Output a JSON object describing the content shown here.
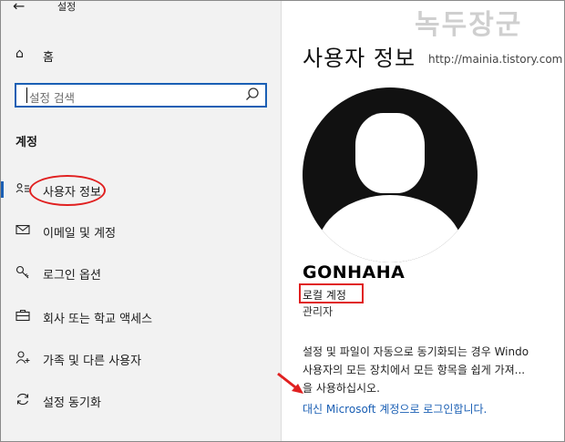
{
  "window": {
    "title": "설정",
    "back_icon": "back-arrow-icon"
  },
  "sidebar": {
    "home_label": "홈",
    "search_placeholder": "설정 검색",
    "section_title": "계정",
    "items": [
      {
        "label": "사용자 정보",
        "icon": "person-list-icon",
        "active": true
      },
      {
        "label": "이메일 및 계정",
        "icon": "mail-icon",
        "active": false
      },
      {
        "label": "로그인 옵션",
        "icon": "key-icon",
        "active": false
      },
      {
        "label": "회사 또는 학교 액세스",
        "icon": "briefcase-icon",
        "active": false
      },
      {
        "label": "가족 및 다른 사용자",
        "icon": "add-person-icon",
        "active": false
      },
      {
        "label": "설정 동기화",
        "icon": "sync-icon",
        "active": false
      }
    ]
  },
  "main": {
    "title": "사용자 정보",
    "user_name": "GONHAHA",
    "account_type": "로컬 계정",
    "role": "관리자",
    "description_lines": [
      "설정 및 파일이 자동으로 동기화되는 경우 Windo",
      "사용자의 모든 장치에서 모든 항목을 쉽게 가져...",
      "을 사용하십시오."
    ],
    "link_text": "대신 Microsoft 계정으로 로그인합니다."
  },
  "watermark": {
    "text": "녹두장군",
    "url": "http://mainia.tistory.com"
  },
  "colors": {
    "accent": "#1a5fb4",
    "annotation": "#e02020",
    "sidebar_bg": "#f2f2f2"
  }
}
